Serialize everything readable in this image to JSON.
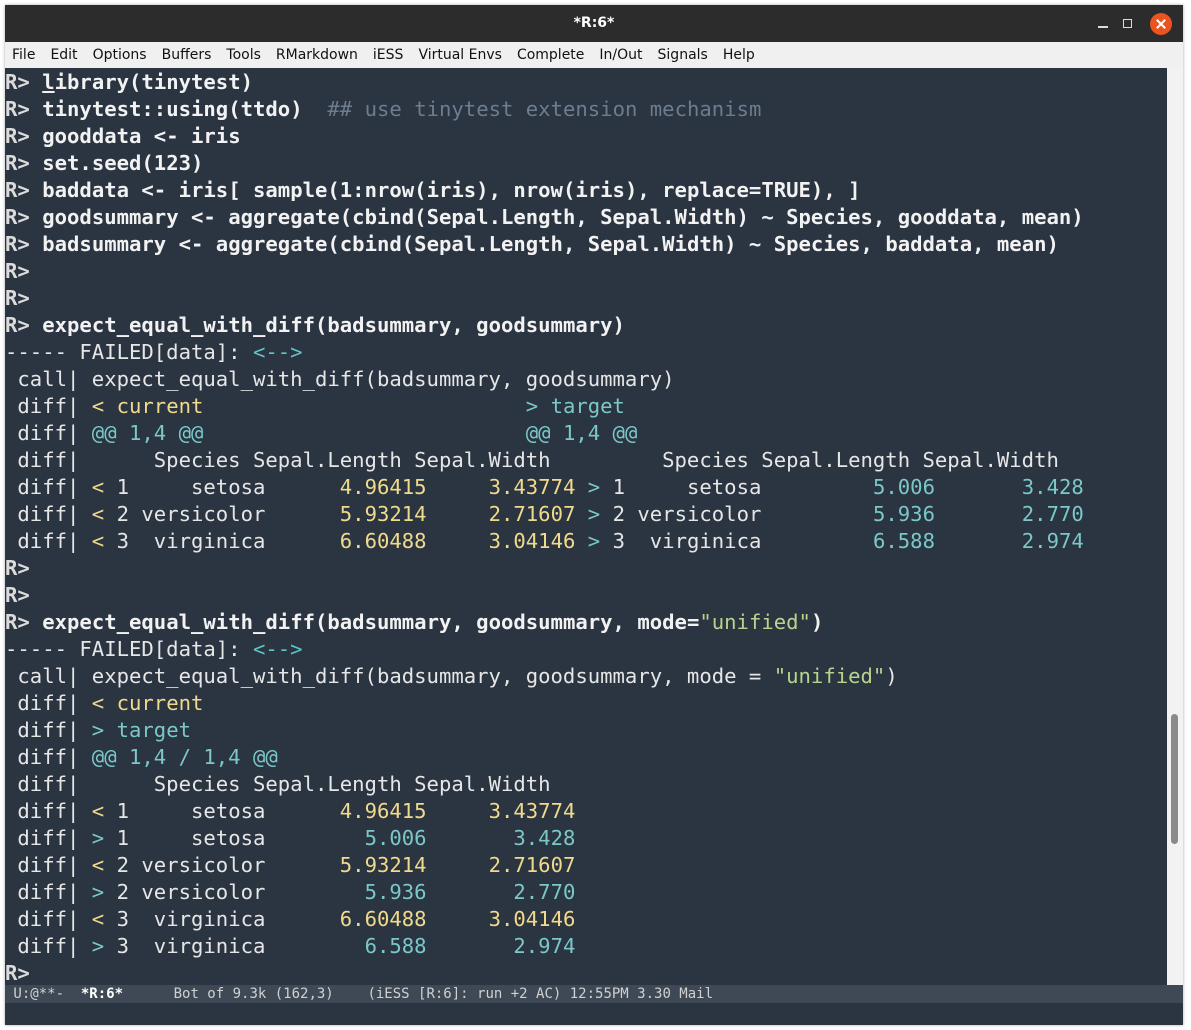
{
  "window": {
    "title": "*R:6*"
  },
  "menu": [
    "File",
    "Edit",
    "Options",
    "Buffers",
    "Tools",
    "RMarkdown",
    "iESS",
    "Virtual Envs",
    "Complete",
    "In/Out",
    "Signals",
    "Help"
  ],
  "console": {
    "prompt": "R>",
    "lines": [
      {
        "type": "cmd",
        "text": "library(tinytest)"
      },
      {
        "type": "cmd",
        "text": "tinytest::using(ttdo)",
        "comment": "## use tinytest extension mechanism"
      },
      {
        "type": "cmd",
        "text": "gooddata <- iris"
      },
      {
        "type": "cmd",
        "text": "set.seed(123)"
      },
      {
        "type": "cmd",
        "text": "baddata <- iris[ sample(1:nrow(iris), nrow(iris), replace=TRUE), ]"
      },
      {
        "type": "cmd",
        "text": "goodsummary <- aggregate(cbind(Sepal.Length, Sepal.Width) ~ Species, gooddata, mean)"
      },
      {
        "type": "cmd",
        "text": "badsummary <- aggregate(cbind(Sepal.Length, Sepal.Width) ~ Species, baddata, mean)"
      },
      {
        "type": "cmd",
        "text": ""
      },
      {
        "type": "cmd",
        "text": ""
      },
      {
        "type": "cmd",
        "text": "expect_equal_with_diff(badsummary, goodsummary)"
      },
      {
        "type": "fail",
        "text": "----- FAILED[data]: ",
        "arrow": "<-->"
      },
      {
        "type": "call",
        "text": " call| expect_equal_with_diff(badsummary, goodsummary)"
      },
      {
        "type": "diff2",
        "label": " diff| ",
        "a": "< current",
        "gap": "                          ",
        "b": "> target",
        "aclass": "cur",
        "bclass": "tgt"
      },
      {
        "type": "diff2",
        "label": " diff| ",
        "a": "@@ 1,4 @@",
        "gap": "                          ",
        "b": "@@ 1,4 @@",
        "aclass": "hunk",
        "bclass": "hunk"
      },
      {
        "type": "plain",
        "text": " diff|      Species Sepal.Length Sepal.Width         Species Sepal.Length Sepal.Width"
      },
      {
        "type": "row2",
        "label": " diff| ",
        "amark": "<",
        "arow": " 1     setosa      ",
        "av1": "4.96415",
        "asep": "     ",
        "av2": "3.43774",
        "bmark": " >",
        "brow": " 1     setosa         ",
        "bv1": "5.006",
        "bsep": "       ",
        "bv2": "3.428"
      },
      {
        "type": "row2",
        "label": " diff| ",
        "amark": "<",
        "arow": " 2 versicolor      ",
        "av1": "5.93214",
        "asep": "     ",
        "av2": "2.71607",
        "bmark": " >",
        "brow": " 2 versicolor         ",
        "bv1": "5.936",
        "bsep": "       ",
        "bv2": "2.770"
      },
      {
        "type": "row2",
        "label": " diff| ",
        "amark": "<",
        "arow": " 3  virginica      ",
        "av1": "6.60488",
        "asep": "     ",
        "av2": "3.04146",
        "bmark": " >",
        "brow": " 3  virginica         ",
        "bv1": "6.588",
        "bsep": "       ",
        "bv2": "2.974"
      },
      {
        "type": "cmd",
        "text": ""
      },
      {
        "type": "cmd",
        "text": ""
      },
      {
        "type": "cmdstr",
        "text": "expect_equal_with_diff(badsummary, goodsummary, mode=",
        "str": "\"unified\"",
        "tail": ")"
      },
      {
        "type": "fail",
        "text": "----- FAILED[data]: ",
        "arrow": "<-->"
      },
      {
        "type": "callstr",
        "text": " call| expect_equal_with_diff(badsummary, goodsummary, mode = ",
        "str": "\"unified\"",
        "tail": ")"
      },
      {
        "type": "diff1",
        "label": " diff| ",
        "a": "< current",
        "aclass": "cur"
      },
      {
        "type": "diff1",
        "label": " diff| ",
        "a": "> target",
        "aclass": "tgt"
      },
      {
        "type": "diff1",
        "label": " diff| ",
        "a": "@@ 1,4 / 1,4 @@",
        "aclass": "hunk"
      },
      {
        "type": "plain",
        "text": " diff|      Species Sepal.Length Sepal.Width"
      },
      {
        "type": "row1",
        "label": " diff| ",
        "mark": "<",
        "row": " 1     setosa      ",
        "v1": "4.96415",
        "sep": "     ",
        "v2": "3.43774",
        "vclass": "num1"
      },
      {
        "type": "row1",
        "label": " diff| ",
        "mark": ">",
        "row": " 1     setosa        ",
        "v1": "5.006",
        "sep": "       ",
        "v2": "3.428",
        "vclass": "num2"
      },
      {
        "type": "row1",
        "label": " diff| ",
        "mark": "<",
        "row": " 2 versicolor      ",
        "v1": "5.93214",
        "sep": "     ",
        "v2": "2.71607",
        "vclass": "num1"
      },
      {
        "type": "row1",
        "label": " diff| ",
        "mark": ">",
        "row": " 2 versicolor        ",
        "v1": "5.936",
        "sep": "       ",
        "v2": "2.770",
        "vclass": "num2"
      },
      {
        "type": "row1",
        "label": " diff| ",
        "mark": "<",
        "row": " 3  virginica      ",
        "v1": "6.60488",
        "sep": "     ",
        "v2": "3.04146",
        "vclass": "num1"
      },
      {
        "type": "row1",
        "label": " diff| ",
        "mark": ">",
        "row": " 3  virginica        ",
        "v1": "6.588",
        "sep": "       ",
        "v2": "2.974",
        "vclass": "num2"
      },
      {
        "type": "cmd",
        "text": ""
      }
    ]
  },
  "modeline": {
    "status": " U:@**-  ",
    "buffer": "*R:6*",
    "position": "      Bot of 9.3k (162,3)    (iESS [R:6]: run +2 AC) 12:55PM 3.30 Mail"
  }
}
